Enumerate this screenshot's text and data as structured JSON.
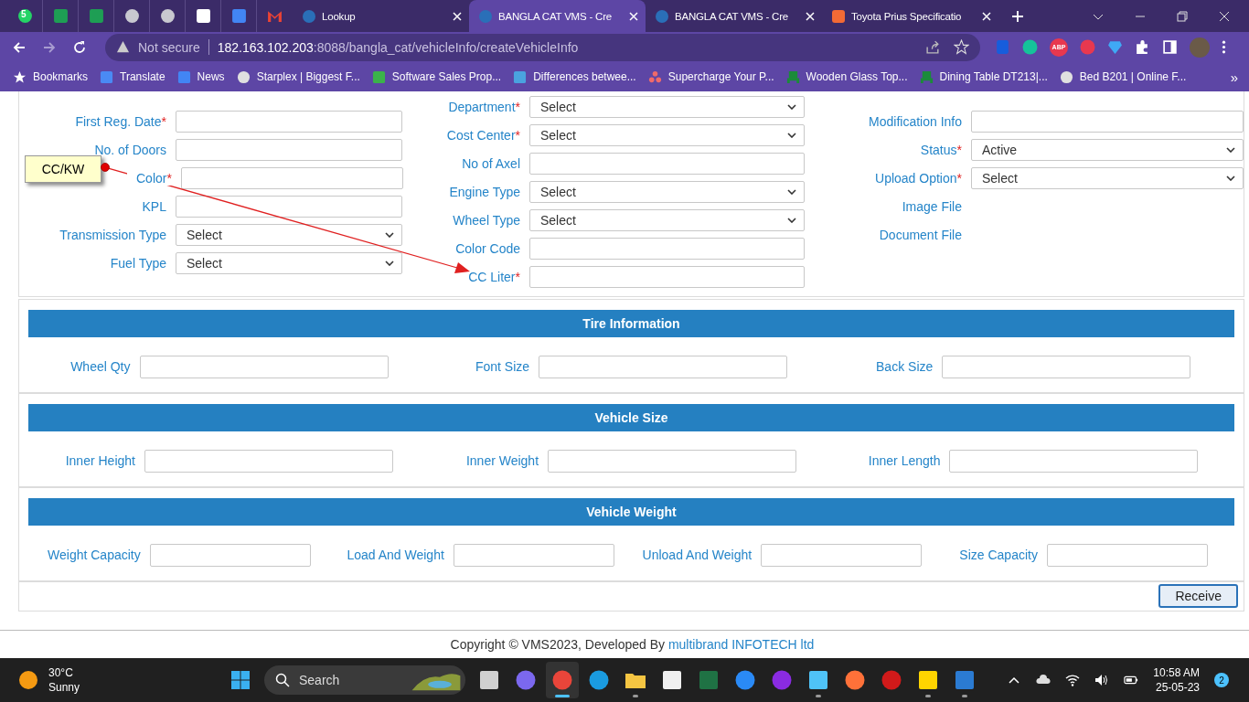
{
  "browser": {
    "pinned": [
      {
        "kind": "chat",
        "badge": "5"
      },
      {
        "kind": "sheet"
      },
      {
        "kind": "sheet"
      },
      {
        "kind": "globe"
      },
      {
        "kind": "globe"
      },
      {
        "kind": "calendar"
      },
      {
        "kind": "document"
      },
      {
        "kind": "mail"
      }
    ],
    "tabs": [
      {
        "title": "Lookup",
        "selected": false,
        "kind": "gear"
      },
      {
        "title": "BANGLA CAT VMS - Cre",
        "selected": true,
        "kind": "gear"
      },
      {
        "title": "BANGLA CAT VMS - Cre",
        "selected": false,
        "kind": "gear"
      },
      {
        "title": "Toyota Prius Specificatio",
        "selected": false,
        "kind": "app"
      }
    ],
    "address": {
      "security": "Not secure",
      "host": "182.163.102.203",
      "path": ":8088/bangla_cat/vehicleInfo/createVehicleInfo"
    },
    "extensions": [
      {
        "kind": "shield"
      },
      {
        "kind": "circle"
      },
      {
        "kind": "badge",
        "label": "ABP"
      },
      {
        "kind": "circle"
      },
      {
        "kind": "gem"
      },
      {
        "kind": "puzzle"
      }
    ],
    "bookmarks": [
      {
        "title": "Bookmarks",
        "kind": "star"
      },
      {
        "title": "Translate",
        "kind": "translate"
      },
      {
        "title": "News",
        "kind": "news"
      },
      {
        "title": "Starplex | Biggest F...",
        "kind": "globe"
      },
      {
        "title": "Software Sales Prop...",
        "kind": "sheet"
      },
      {
        "title": "Differences betwee...",
        "kind": "square"
      },
      {
        "title": "Supercharge Your P...",
        "kind": "dots"
      },
      {
        "title": "Wooden Glass Top...",
        "kind": "chair"
      },
      {
        "title": "Dining Table DT213|...",
        "kind": "chair"
      },
      {
        "title": "Bed B201 | Online F...",
        "kind": "globe"
      }
    ],
    "more": "»"
  },
  "form": {
    "columns": [
      [
        {
          "label": "First Reg. Date",
          "required_mark": "*",
          "kind": "text"
        },
        {
          "label": "No. of Doors",
          "kind": "text"
        },
        {
          "label": "Color",
          "required_mark": "*",
          "kind": "text"
        },
        {
          "label": "KPL",
          "kind": "text"
        },
        {
          "label": "Transmission Type",
          "kind": "select",
          "value": "Select"
        },
        {
          "label": "Fuel Type",
          "kind": "select",
          "value": "Select"
        }
      ],
      [
        {
          "label": "Department",
          "required_mark": "*",
          "kind": "select",
          "value": "Select"
        },
        {
          "label": "Cost Center",
          "required_mark": "*",
          "kind": "select",
          "value": "Select"
        },
        {
          "label": "No of Axel",
          "kind": "text"
        },
        {
          "label": "Engine Type",
          "kind": "select",
          "value": "Select"
        },
        {
          "label": "Wheel Type",
          "kind": "select",
          "value": "Select"
        },
        {
          "label": "Color Code",
          "kind": "text"
        },
        {
          "label": "CC Liter",
          "required_mark": "*",
          "kind": "text"
        }
      ],
      [
        {
          "label": "Modification Info",
          "kind": "text"
        },
        {
          "label": "Status",
          "required_mark": "*",
          "kind": "select",
          "value": "Active"
        },
        {
          "label": "Upload Option",
          "required_mark": "*",
          "kind": "select",
          "value": "Select"
        },
        {
          "label": "Image File",
          "kind": "label"
        },
        {
          "label": "Document File",
          "kind": "label"
        }
      ]
    ]
  },
  "callout": {
    "text": "CC/KW"
  },
  "sections": [
    {
      "title": "Tire Information",
      "fields": [
        "Wheel Qty",
        "Font Size",
        "Back Size"
      ]
    },
    {
      "title": "Vehicle Size",
      "fields": [
        "Inner Height",
        "Inner Weight",
        "Inner Length"
      ]
    },
    {
      "title": "Vehicle Weight",
      "fields": [
        "Weight Capacity",
        "Load And Weight",
        "Unload And Weight",
        "Size Capacity"
      ]
    }
  ],
  "receive_button": "Receive",
  "footer": {
    "text": "Copyright © VMS2023, Developed By ",
    "link": "multibrand INFOTECH ltd"
  },
  "taskbar": {
    "weather": {
      "temp": "30°C",
      "condition": "Sunny"
    },
    "search": {
      "placeholder": "Search"
    },
    "apps": [
      {
        "kind": "windows",
        "open": false,
        "active": false
      },
      {
        "kind": "taskview",
        "open": false,
        "active": false
      },
      {
        "kind": "video",
        "open": false,
        "active": false
      },
      {
        "kind": "chrome",
        "open": true,
        "active": true
      },
      {
        "kind": "edge",
        "open": false,
        "active": false
      },
      {
        "kind": "folder",
        "open": true,
        "active": false
      },
      {
        "kind": "store",
        "open": false,
        "active": false
      },
      {
        "kind": "excel",
        "open": false,
        "active": false
      },
      {
        "kind": "firefoxdev",
        "open": false,
        "active": false
      },
      {
        "kind": "infinity",
        "open": false,
        "active": false
      },
      {
        "kind": "notepad",
        "open": true,
        "active": false
      },
      {
        "kind": "firefox",
        "open": false,
        "active": false
      },
      {
        "kind": "gearred",
        "open": false,
        "active": false
      },
      {
        "kind": "sticky",
        "open": true,
        "active": false
      },
      {
        "kind": "letter",
        "open": true,
        "active": false
      }
    ],
    "time": "10:58 AM",
    "date": "25-05-23",
    "notifications": "2"
  }
}
